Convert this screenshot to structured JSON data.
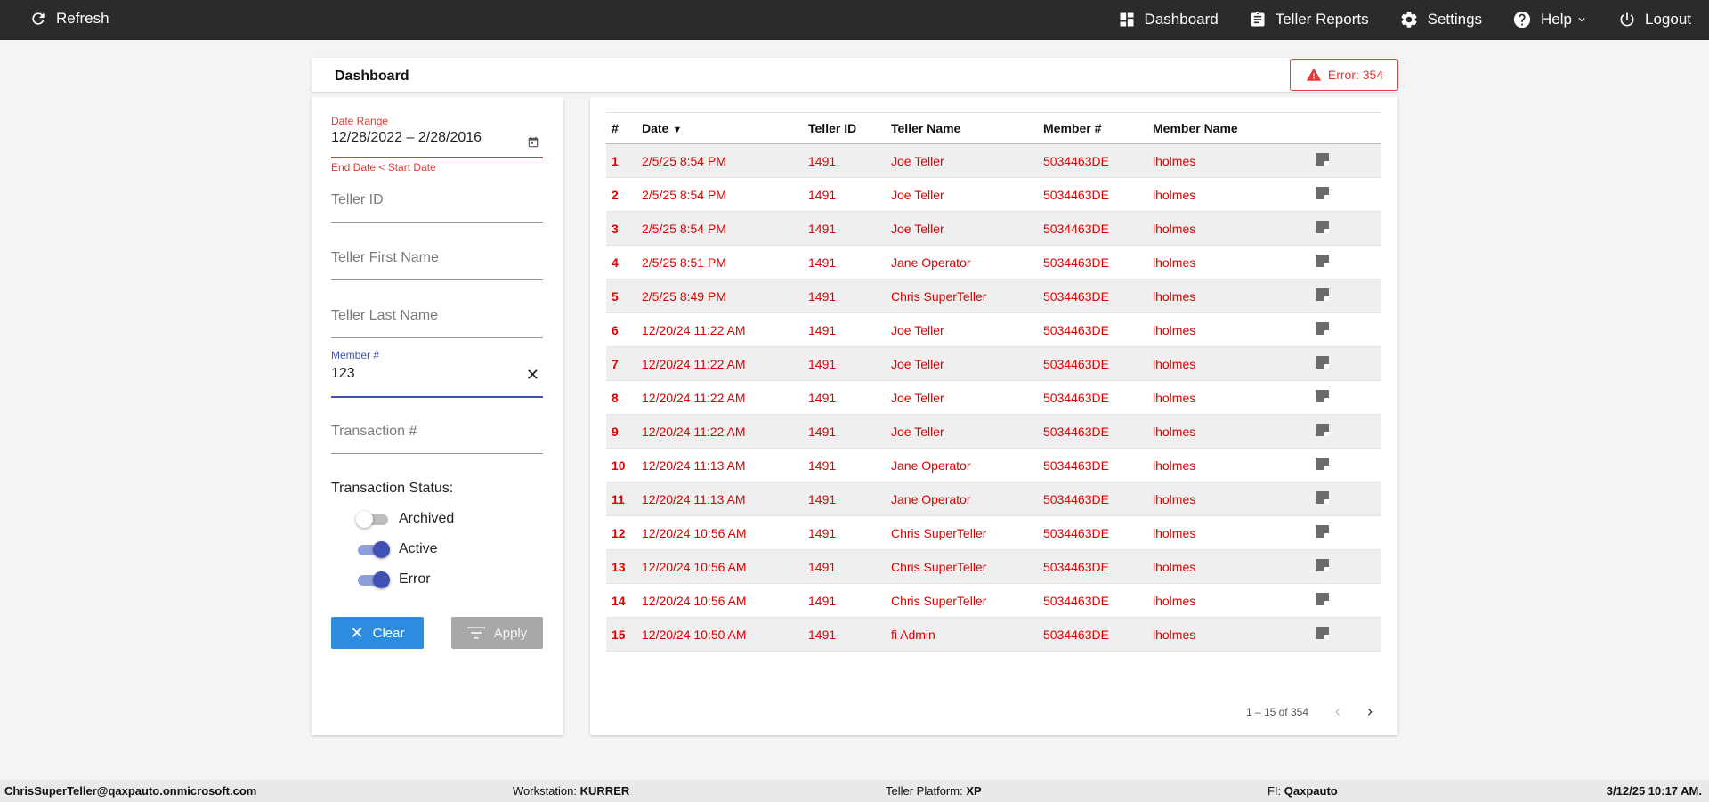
{
  "topbar": {
    "refresh_label": "Refresh",
    "nav": [
      {
        "label": "Dashboard",
        "icon": "dashboard-icon"
      },
      {
        "label": "Teller Reports",
        "icon": "clipboard-icon"
      },
      {
        "label": "Settings",
        "icon": "gear-icon"
      },
      {
        "label": "Help",
        "icon": "help-icon"
      },
      {
        "label": "Logout",
        "icon": "power-icon"
      }
    ]
  },
  "page": {
    "title": "Dashboard",
    "error_label": "Error: 354"
  },
  "filters": {
    "date_range_label": "Date Range",
    "date_range_value": "12/28/2022 – 2/28/2016",
    "date_range_error": "End Date < Start Date",
    "teller_id_placeholder": "Teller ID",
    "teller_first_placeholder": "Teller First Name",
    "teller_last_placeholder": "Teller Last Name",
    "member_label": "Member #",
    "member_value": "123",
    "transaction_placeholder": "Transaction #",
    "status_title": "Transaction Status:",
    "statuses": [
      {
        "label": "Archived",
        "on": false
      },
      {
        "label": "Active",
        "on": true
      },
      {
        "label": "Error",
        "on": true
      }
    ],
    "clear_label": "Clear",
    "apply_label": "Apply"
  },
  "table": {
    "columns": [
      "#",
      "Date",
      "Teller ID",
      "Teller Name",
      "Member #",
      "Member Name"
    ],
    "rows": [
      [
        "1",
        "2/5/25 8:54 PM",
        "1491",
        "Joe Teller",
        "5034463DE",
        "lholmes"
      ],
      [
        "2",
        "2/5/25 8:54 PM",
        "1491",
        "Joe Teller",
        "5034463DE",
        "lholmes"
      ],
      [
        "3",
        "2/5/25 8:54 PM",
        "1491",
        "Joe Teller",
        "5034463DE",
        "lholmes"
      ],
      [
        "4",
        "2/5/25 8:51 PM",
        "1491",
        "Jane Operator",
        "5034463DE",
        "lholmes"
      ],
      [
        "5",
        "2/5/25 8:49 PM",
        "1491",
        "Chris SuperTeller",
        "5034463DE",
        "lholmes"
      ],
      [
        "6",
        "12/20/24 11:22 AM",
        "1491",
        "Joe Teller",
        "5034463DE",
        "lholmes"
      ],
      [
        "7",
        "12/20/24 11:22 AM",
        "1491",
        "Joe Teller",
        "5034463DE",
        "lholmes"
      ],
      [
        "8",
        "12/20/24 11:22 AM",
        "1491",
        "Joe Teller",
        "5034463DE",
        "lholmes"
      ],
      [
        "9",
        "12/20/24 11:22 AM",
        "1491",
        "Joe Teller",
        "5034463DE",
        "lholmes"
      ],
      [
        "10",
        "12/20/24 11:13 AM",
        "1491",
        "Jane Operator",
        "5034463DE",
        "lholmes"
      ],
      [
        "11",
        "12/20/24 11:13 AM",
        "1491",
        "Jane Operator",
        "5034463DE",
        "lholmes"
      ],
      [
        "12",
        "12/20/24 10:56 AM",
        "1491",
        "Chris SuperTeller",
        "5034463DE",
        "lholmes"
      ],
      [
        "13",
        "12/20/24 10:56 AM",
        "1491",
        "Chris SuperTeller",
        "5034463DE",
        "lholmes"
      ],
      [
        "14",
        "12/20/24 10:56 AM",
        "1491",
        "Chris SuperTeller",
        "5034463DE",
        "lholmes"
      ],
      [
        "15",
        "12/20/24 10:50 AM",
        "1491",
        "fi Admin",
        "5034463DE",
        "lholmes"
      ]
    ],
    "pager_text": "1 – 15 of 354"
  },
  "footer": {
    "user": "ChrisSuperTeller@qaxpauto.onmicrosoft.com",
    "workstation_label": "Workstation:",
    "workstation_value": "KURRER",
    "platform_label": "Teller Platform:",
    "platform_value": "XP",
    "fi_label": "FI:",
    "fi_value": "Qaxpauto",
    "datetime": "3/12/25 10:17 AM."
  },
  "colors": {
    "topbar_bg": "#2b2b2b",
    "error_red": "#e53935",
    "row_text_red": "#e00000",
    "toggle_on": "#3f51b5",
    "clear_blue": "#2d8ce0"
  }
}
